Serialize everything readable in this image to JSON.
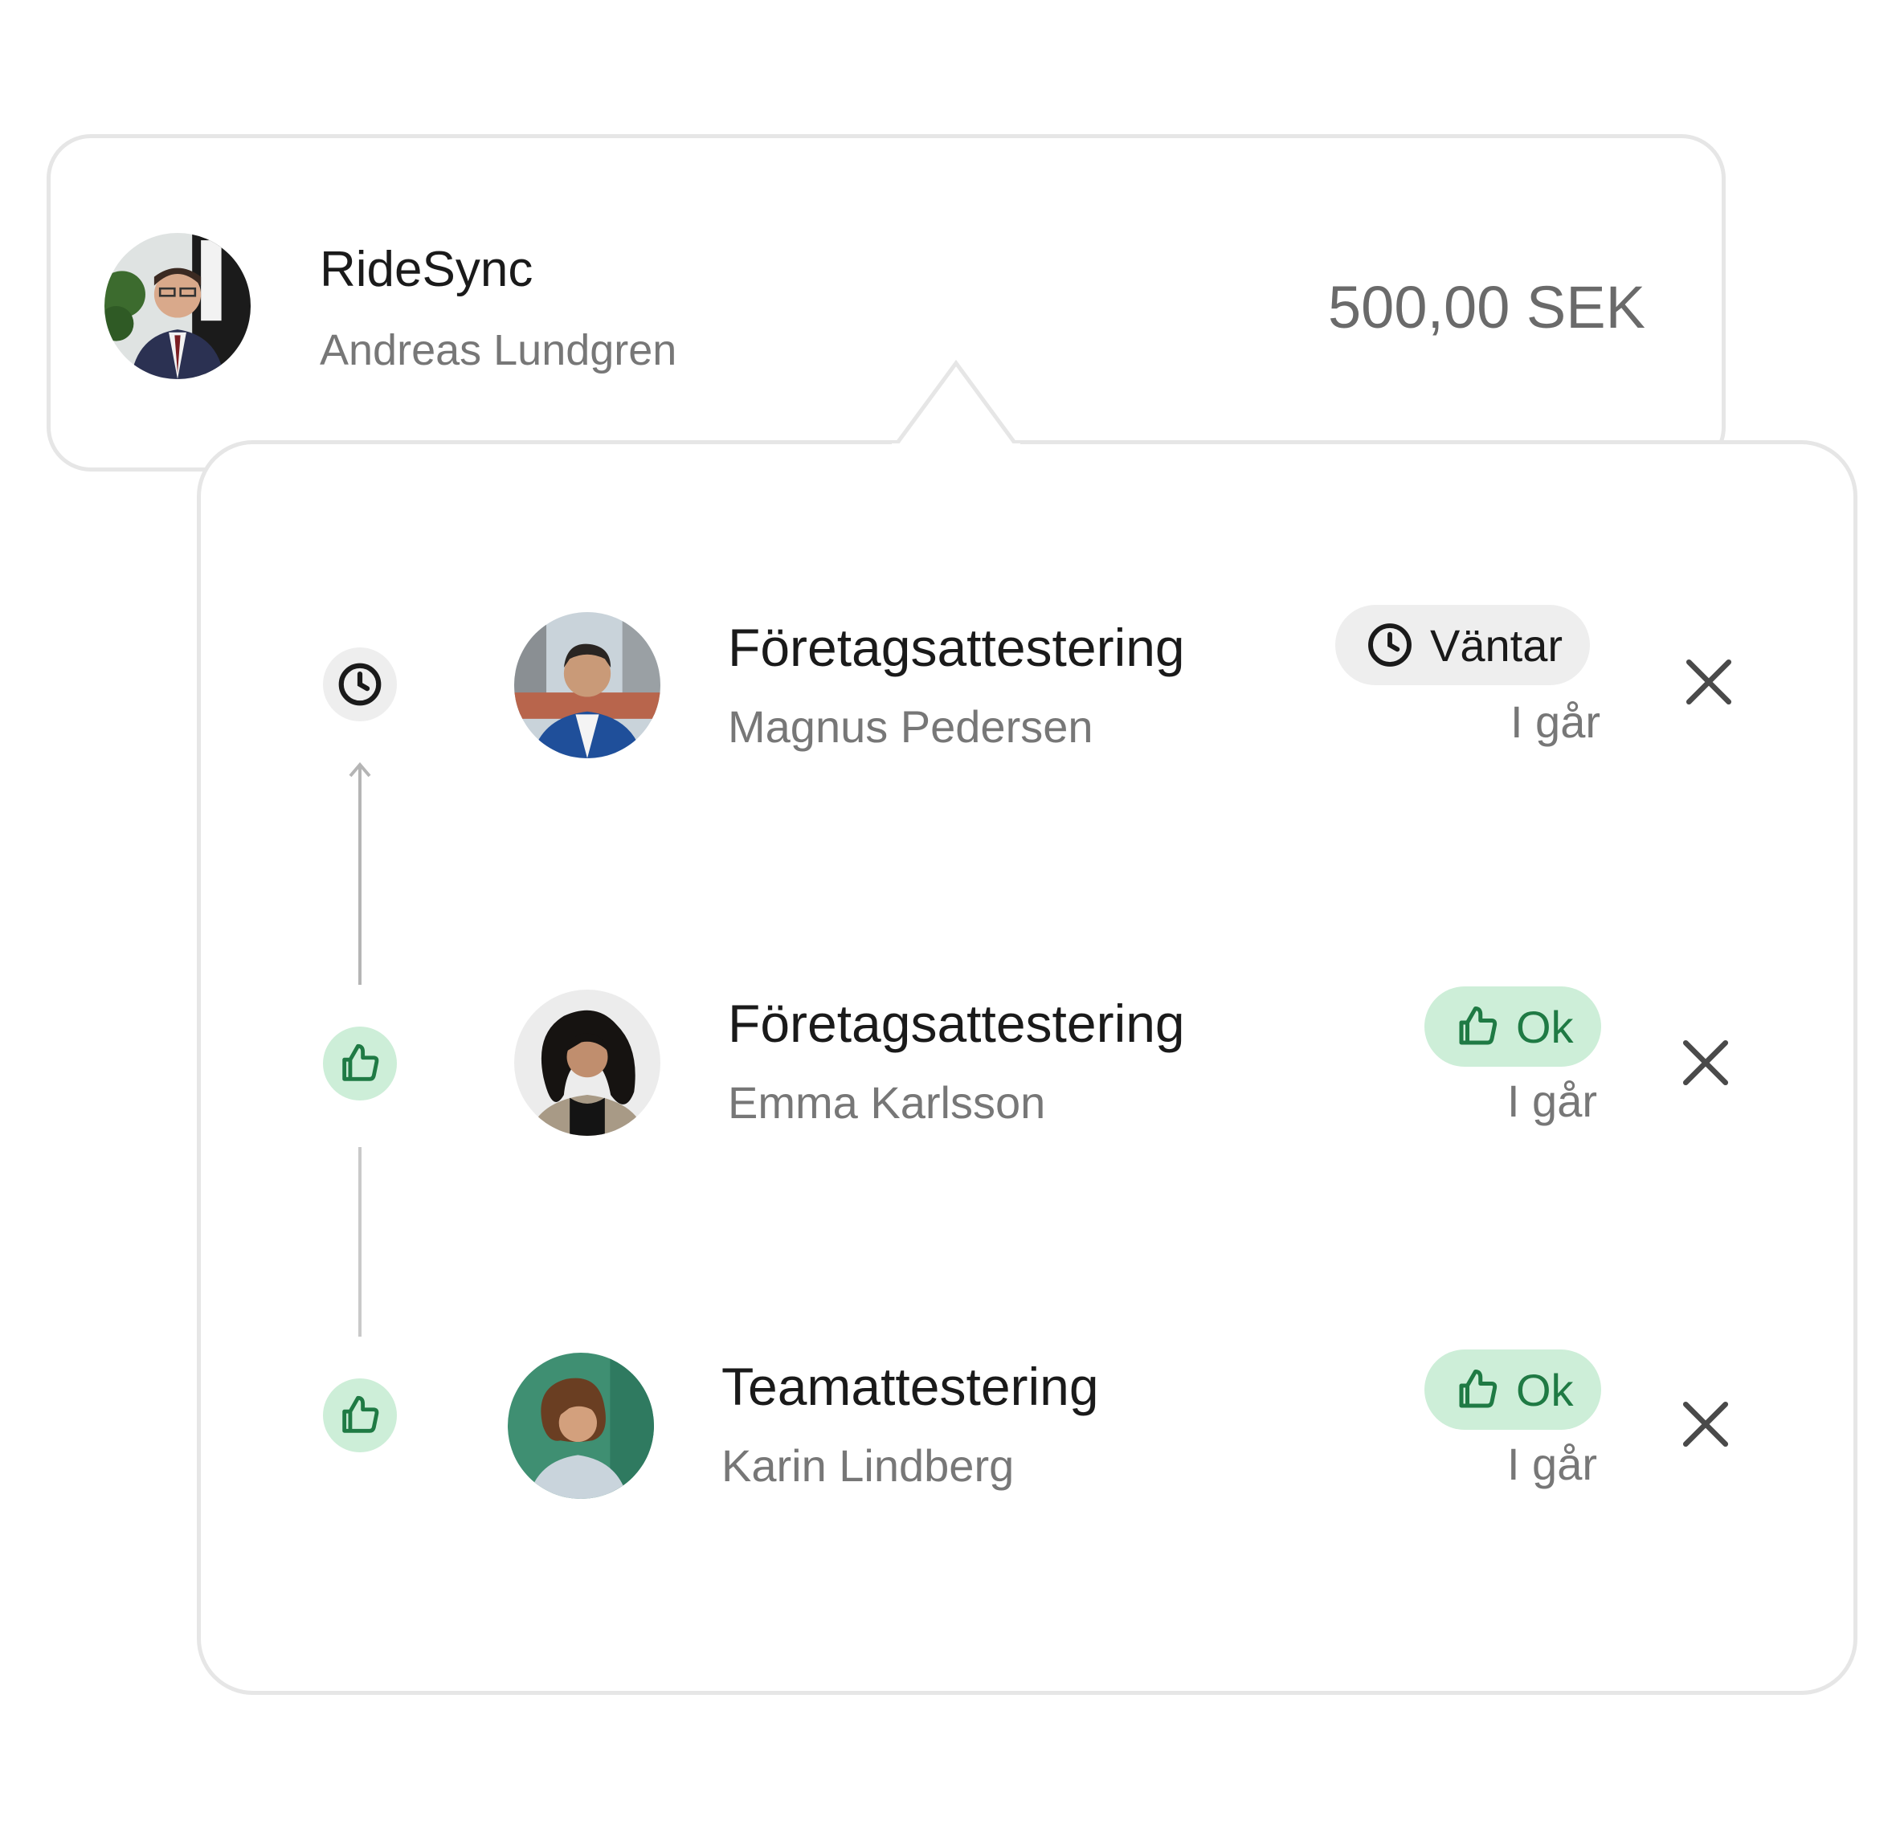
{
  "merchant": {
    "name": "RideSync",
    "person": "Andreas Lundgren",
    "amount": "500,00 SEK",
    "avatar": "person-photo"
  },
  "approvals": [
    {
      "title": "Företagsattestering",
      "person": "Magnus Pedersen",
      "status": "Väntar",
      "status_type": "pending",
      "status_icon": "clock-icon",
      "time": "I går"
    },
    {
      "title": "Företagsattestering",
      "person": "Emma Karlsson",
      "status": "Ok",
      "status_type": "ok",
      "status_icon": "thumbs-up-icon",
      "time": "I går"
    },
    {
      "title": "Teamattestering",
      "person": "Karin Lindberg",
      "status": "Ok",
      "status_type": "ok",
      "status_icon": "thumbs-up-icon",
      "time": "I går"
    }
  ],
  "colors": {
    "ok_bg": "#cdeed8",
    "ok_fg": "#1f7a44",
    "pending_bg": "#eeeeee",
    "border": "#e6e6e6"
  }
}
